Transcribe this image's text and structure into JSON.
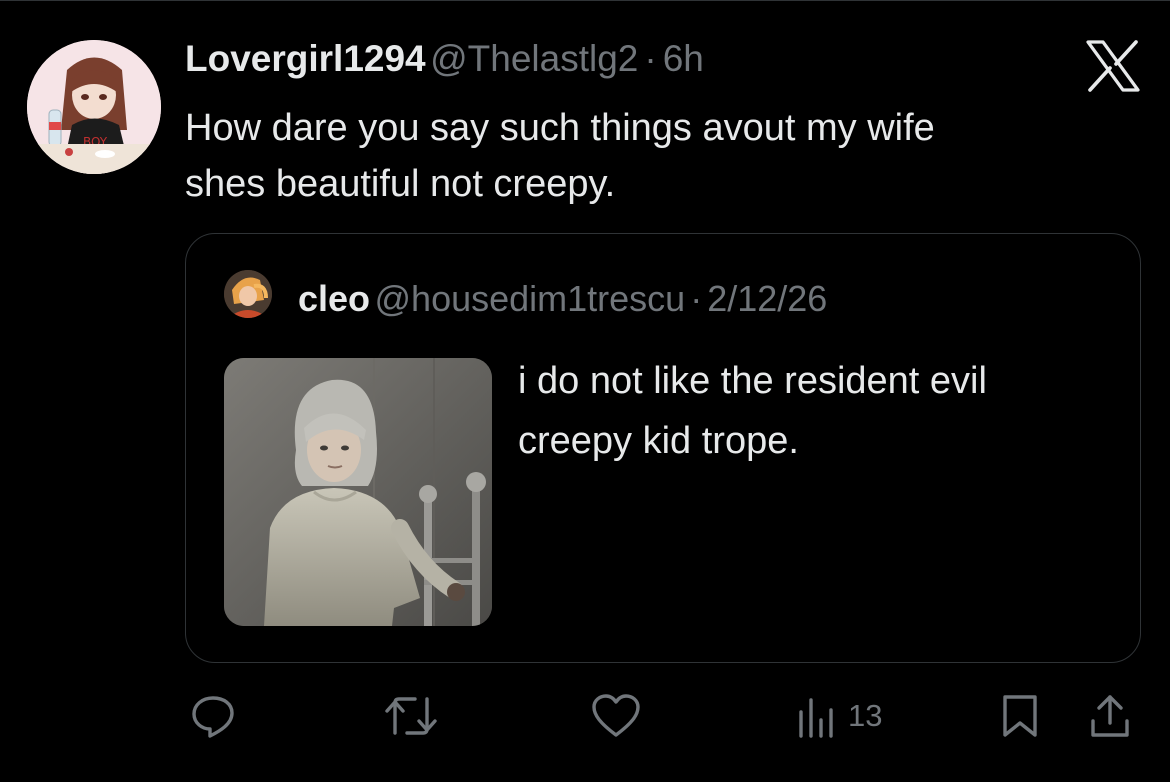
{
  "tweet": {
    "display_name": "Lovergirl1294",
    "handle": "@Thelastlg2",
    "separator": "·",
    "time": "6h",
    "text_line1": "How dare you say such things avout my wife",
    "text_line2": "shes beautiful not creepy."
  },
  "quote": {
    "display_name": "cleo",
    "handle": "@housedim1trescu",
    "separator": "·",
    "date": "2/12/26",
    "text_line1": "i do not like the resident evil",
    "text_line2": "creepy kid trope."
  },
  "actions": {
    "reply_icon": "reply-icon",
    "retweet_icon": "retweet-icon",
    "like_icon": "heart-icon",
    "views_icon": "views-icon",
    "views_count": "13",
    "bookmark_icon": "bookmark-icon",
    "share_icon": "share-icon"
  },
  "colors": {
    "background": "#000000",
    "primary_text": "#e7e9ea",
    "secondary_text": "#71767b",
    "border": "#2f3336"
  }
}
